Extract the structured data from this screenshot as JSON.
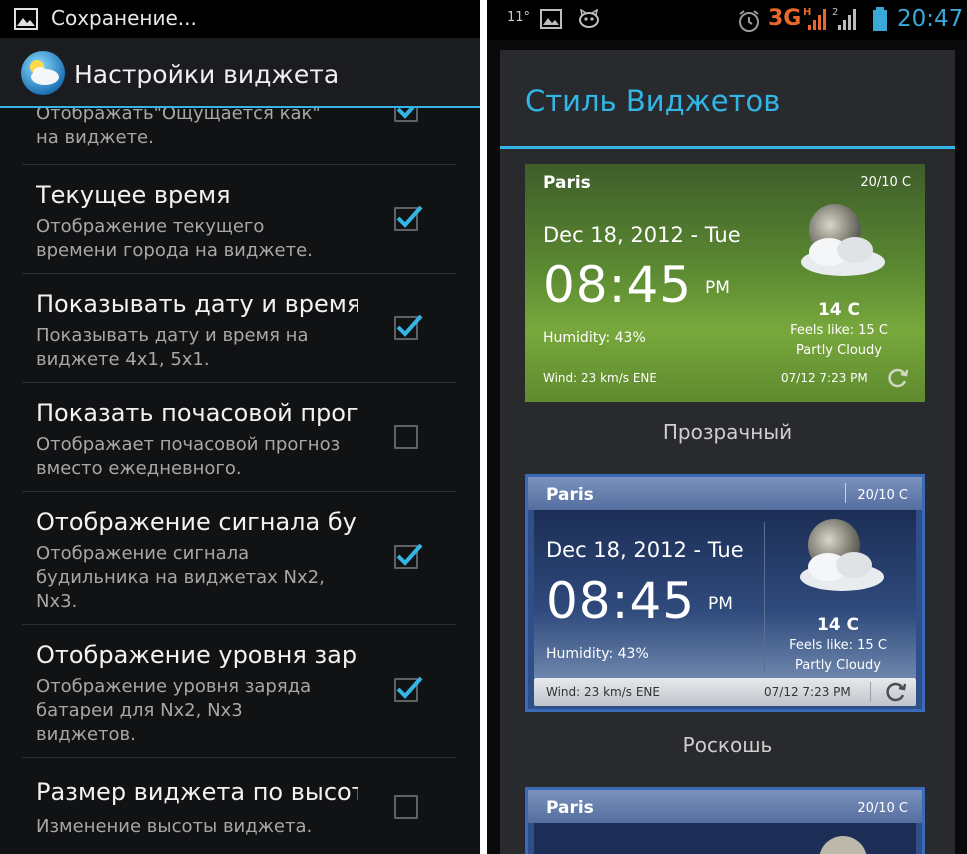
{
  "left": {
    "status": {
      "text": "Сохранение..."
    },
    "actionbar": {
      "title": "Настройки виджета"
    },
    "partial_item": {
      "summary": "Отображать\"Ощущается как\"\nна виджете.",
      "checked": true
    },
    "prefs": [
      {
        "title": "Текущее время",
        "summary": "Отображение текущего\nвремени города на виджете.",
        "checked": true
      },
      {
        "title": "Показывать дату и время",
        "summary": "Показывать дату и время на\nвиджете 4x1, 5x1.",
        "checked": true
      },
      {
        "title": "Показать почасовой прогноз",
        "summary": "Отображает почасовой прогноз\nвместо ежедневного.",
        "checked": false
      },
      {
        "title": "Отображение сигнала будильника",
        "summary": "Отображение сигнала\nбудильника на виджетах Nx2,\nNx3.",
        "checked": true
      },
      {
        "title": "Отображение уровня заряда",
        "summary": "Отображение уровня заряда\nбатареи для Nx2, Nx3\nвиджетов.",
        "checked": true
      },
      {
        "title": "Размер виджета по высоте",
        "summary": "Изменение высоты виджета.",
        "checked": false
      }
    ]
  },
  "right": {
    "status": {
      "temp": "11°",
      "network": "3G",
      "clock": "20:47"
    },
    "dialog": {
      "title": "Стиль Виджетов"
    },
    "widgets": [
      {
        "city": "Paris",
        "range": "20/10 C",
        "date": "Dec 18, 2012 - Tue",
        "time": "08:45",
        "ampm": "PM",
        "humidity": "Humidity: 43%",
        "temp": "14 C",
        "feels": "Feels like: 15 C",
        "condition": "Partly Cloudy",
        "wind": "Wind: 23 km/s ENE",
        "updated": "07/12 7:23 PM",
        "label": "Прозрачный"
      },
      {
        "city": "Paris",
        "range": "20/10 C",
        "date": "Dec 18, 2012 - Tue",
        "time": "08:45",
        "ampm": "PM",
        "humidity": "Humidity: 43%",
        "temp": "14 C",
        "feels": "Feels like: 15 C",
        "condition": "Partly Cloudy",
        "wind": "Wind: 23 km/s ENE",
        "updated": "07/12 7:23 PM",
        "label": "Роскошь"
      },
      {
        "city": "Paris",
        "range": "20/10 C"
      }
    ]
  }
}
